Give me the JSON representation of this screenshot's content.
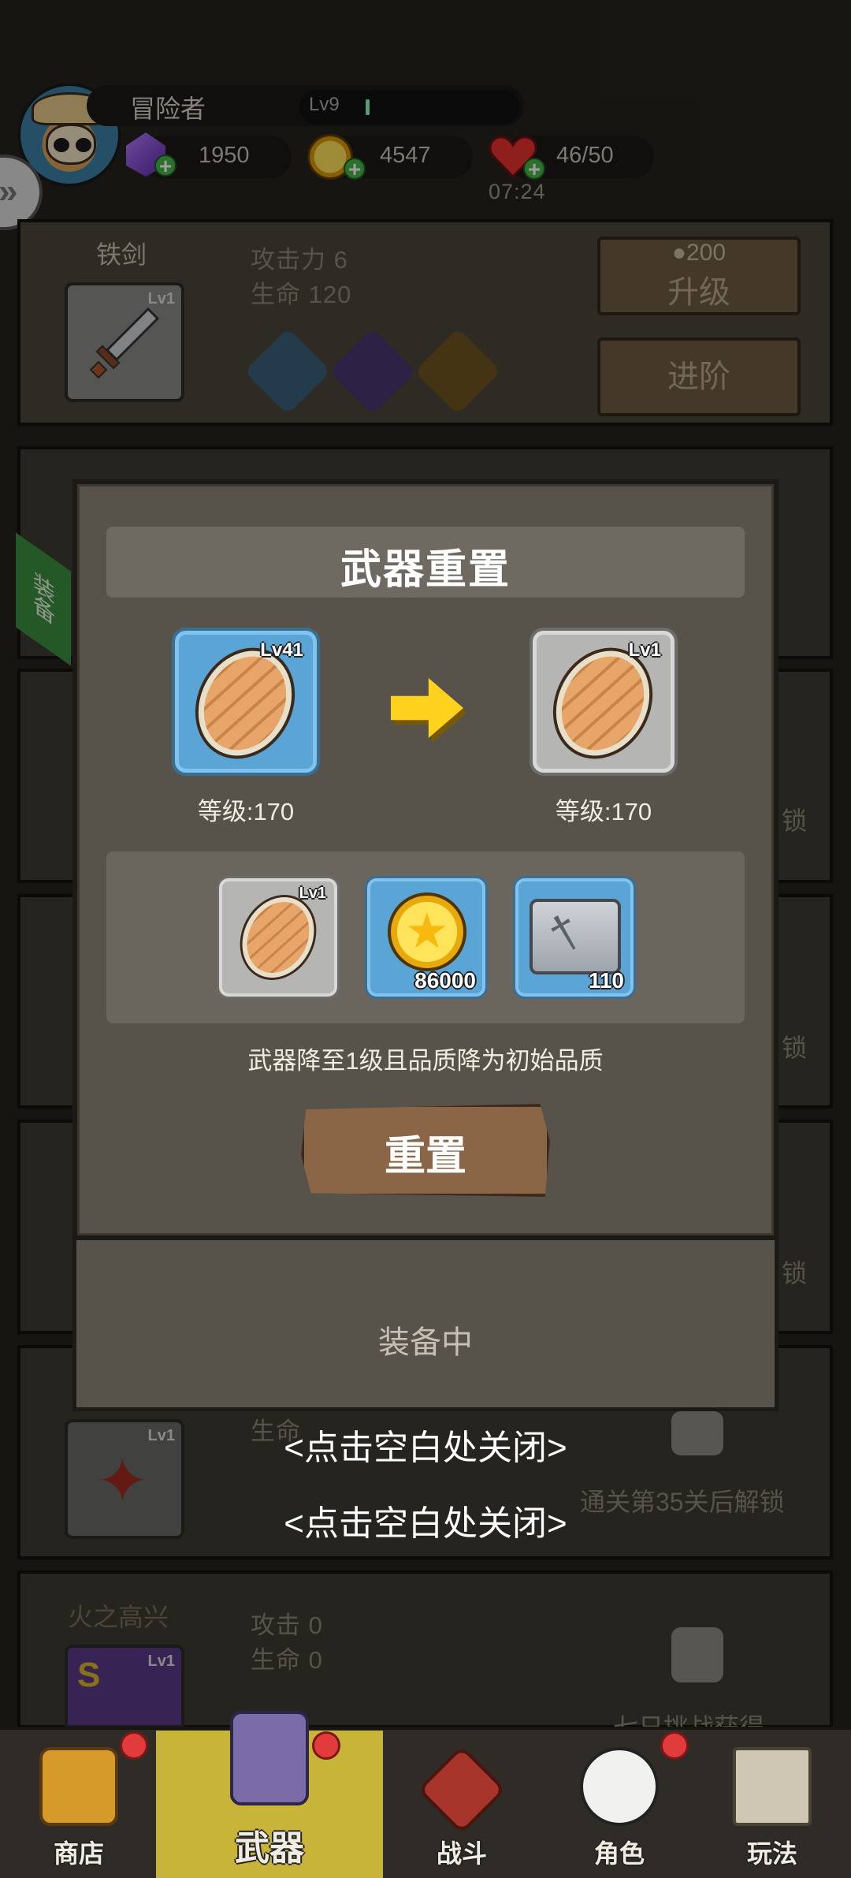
{
  "player": {
    "name": "冒险者",
    "level": "Lv9",
    "gems": "1950",
    "coins": "4547",
    "stamina": "46/50",
    "stamina_timer": "07:24"
  },
  "weapon_list": {
    "current": {
      "name": "铁剑",
      "slot_level": "Lv1",
      "attack": "攻击力 6",
      "life": "生命 120",
      "upgrade_cost": "200",
      "upgrade_label": "升级",
      "advance_label": "进阶"
    },
    "side_tag": "装备",
    "locked_label": "锁",
    "locked_row_text": "通关第35关后解锁",
    "row5_name": "火之高兴",
    "row5_attack": "攻击 0",
    "row5_life": "生命 0",
    "row5_slot_level": "Lv1",
    "row5_unlock": "七日挑战获得",
    "row4_slot_level": "Lv1",
    "row4_partial": "生命"
  },
  "modal": {
    "title": "武器重置",
    "from_level": "Lv41",
    "to_level": "Lv1",
    "from_grade": "等级:170",
    "to_grade": "等级:170",
    "cost_items": [
      {
        "name": "shield",
        "level": "Lv1",
        "qty": ""
      },
      {
        "name": "gold-coin",
        "level": "",
        "qty": "86000"
      },
      {
        "name": "weapon-scroll",
        "level": "",
        "qty": "110"
      }
    ],
    "note": "武器降至1级且品质降为初始品质",
    "confirm_label": "重置",
    "equipped_label": "装备中"
  },
  "close_hints": [
    "<点击空白处关闭>",
    "<点击空白处关闭>"
  ],
  "nav": {
    "items": [
      {
        "label": "商店",
        "icon": "chest-icon"
      },
      {
        "label": "武器",
        "icon": "weapon-icon"
      },
      {
        "label": "战斗",
        "icon": "swords-icon"
      },
      {
        "label": "角色",
        "icon": "panda-icon"
      },
      {
        "label": "玩法",
        "icon": "castle-icon"
      }
    ],
    "active": "武器"
  },
  "colors": {
    "modal_bg": "#58534a",
    "accent_gold": "#ffd21e",
    "nav_active": "#c9b43a",
    "badge_red": "#e23b3b"
  }
}
